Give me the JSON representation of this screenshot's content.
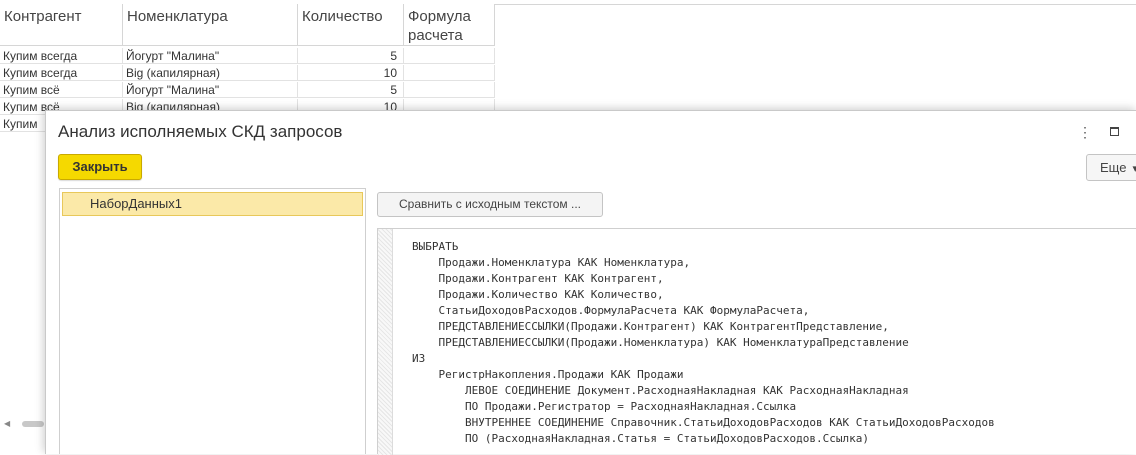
{
  "table": {
    "headers": [
      "Контрагент",
      "Номенклатура",
      "Количество",
      "Формула расчета"
    ],
    "header_formula_line1": "Формула",
    "header_formula_line2": "расчета",
    "rows": [
      {
        "counterparty": "Купим всегда",
        "item": "Йогурт \"Малина\"",
        "qty": "5",
        "formula": ""
      },
      {
        "counterparty": "Купим всегда",
        "item": "Big (капилярная)",
        "qty": "10",
        "formula": ""
      },
      {
        "counterparty": "Купим всё",
        "item": "Йогурт \"Малина\"",
        "qty": "5",
        "formula": ""
      },
      {
        "counterparty": "Купим всё",
        "item": "Big (капилярная)",
        "qty": "10",
        "formula": ""
      },
      {
        "counterparty": "Купим",
        "item": "",
        "qty": "",
        "formula": ""
      }
    ]
  },
  "dialog": {
    "title": "Анализ исполняемых СКД запросов",
    "close_label": "Закрыть",
    "more_label": "Еще",
    "more_icon": "chevron-down-icon",
    "kebab_icon": "kebab-icon",
    "maximize_icon": "maximize-icon",
    "datasets": [
      "НаборДанных1"
    ],
    "compare_label": "Сравнить с исходным текстом ...",
    "code_lines": [
      "ВЫБРАТЬ",
      "    Продажи.Номенклатура КАК Номенклатура,",
      "    Продажи.Контрагент КАК Контрагент,",
      "    Продажи.Количество КАК Количество,",
      "    СтатьиДоходовРасходов.ФормулаРасчета КАК ФормулаРасчета,",
      "    ПРЕДСТАВЛЕНИЕССЫЛКИ(Продажи.Контрагент) КАК КонтрагентПредставление,",
      "    ПРЕДСТАВЛЕНИЕССЫЛКИ(Продажи.Номенклатура) КАК НоменклатураПредставление",
      "ИЗ",
      "    РегистрНакопления.Продажи КАК Продажи",
      "        ЛЕВОЕ СОЕДИНЕНИЕ Документ.РасходнаяНакладная КАК РасходнаяНакладная",
      "        ПО Продажи.Регистратор = РасходнаяНакладная.Ссылка",
      "        ВНУТРЕННЕЕ СОЕДИНЕНИЕ Справочник.СтатьиДоходовРасходов КАК СтатьиДоходовРасходов",
      "        ПО (РасходнаяНакладная.Статья = СтатьиДоходовРасходов.Ссылка)"
    ]
  },
  "colors": {
    "accent_button": "#f5d900",
    "selected_item": "#fbe9a8"
  }
}
